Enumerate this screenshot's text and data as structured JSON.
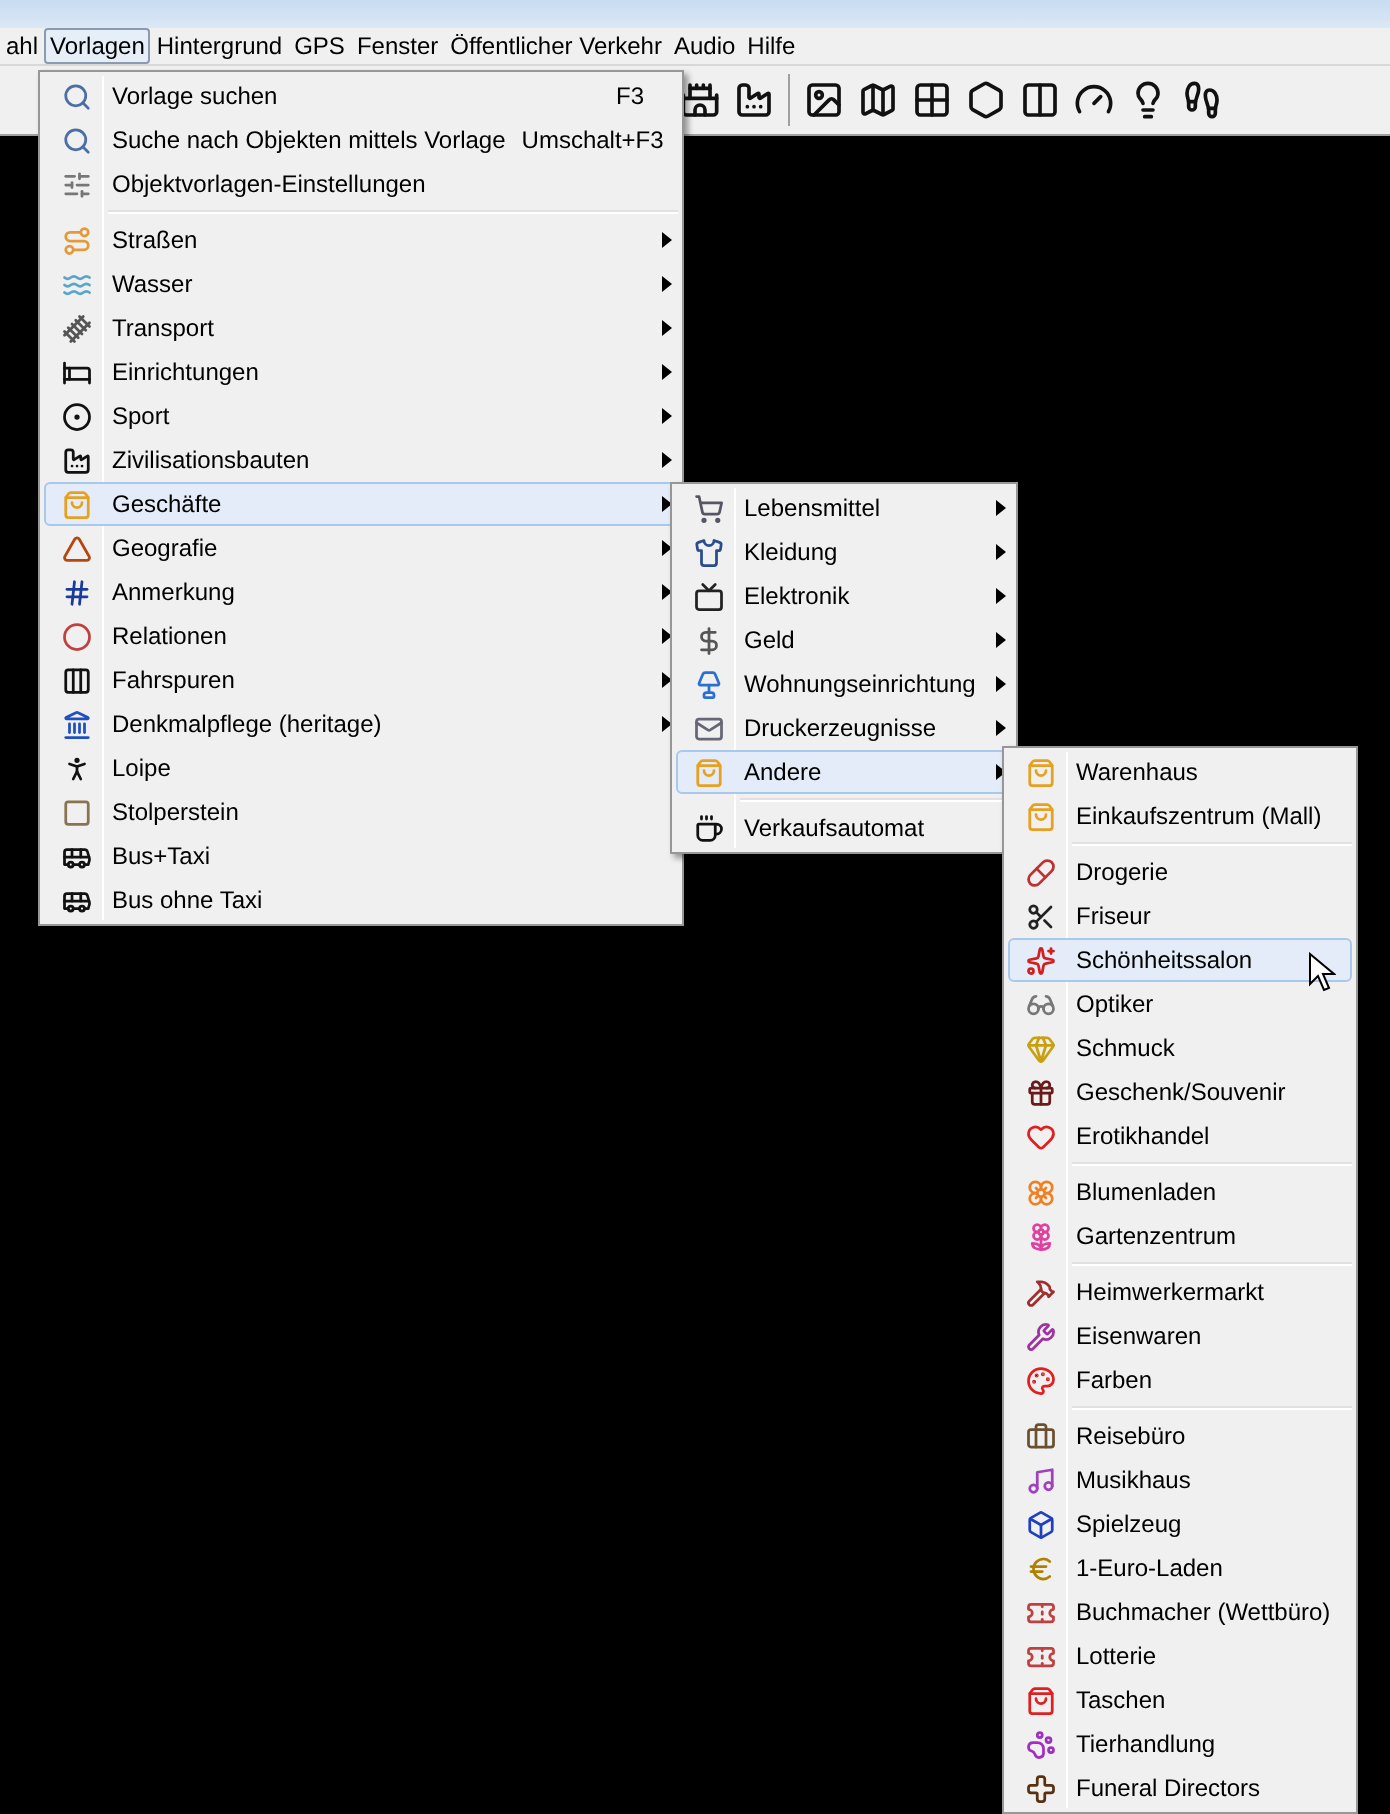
{
  "menu_bar": {
    "items": [
      {
        "label": "ahl",
        "selected": false
      },
      {
        "label": "Vorlagen",
        "selected": true
      },
      {
        "label": "Hintergrund",
        "selected": false
      },
      {
        "label": "GPS",
        "selected": false
      },
      {
        "label": "Fenster",
        "selected": false
      },
      {
        "label": "Öffentlicher Verkehr",
        "selected": false
      },
      {
        "label": "Audio",
        "selected": false
      },
      {
        "label": "Hilfe",
        "selected": false
      }
    ]
  },
  "presets_menu": {
    "groups": [
      [
        {
          "label": "Vorlage suchen",
          "shortcut": "F3",
          "submenu": false,
          "selected": false
        },
        {
          "label": "Suche nach Objekten mittels Vorlage",
          "shortcut": "Umschalt+F3",
          "submenu": false,
          "selected": false
        },
        {
          "label": "Objektvorlagen-Einstellungen",
          "submenu": false,
          "selected": false
        }
      ],
      [
        {
          "label": "Straßen",
          "submenu": true,
          "selected": false
        },
        {
          "label": "Wasser",
          "submenu": true,
          "selected": false
        },
        {
          "label": "Transport",
          "submenu": true,
          "selected": false
        },
        {
          "label": "Einrichtungen",
          "submenu": true,
          "selected": false
        },
        {
          "label": "Sport",
          "submenu": true,
          "selected": false
        },
        {
          "label": "Zivilisationsbauten",
          "submenu": true,
          "selected": false
        },
        {
          "label": "Geschäfte",
          "submenu": true,
          "selected": true
        },
        {
          "label": "Geografie",
          "submenu": true,
          "selected": false
        },
        {
          "label": "Anmerkung",
          "submenu": true,
          "selected": false
        },
        {
          "label": "Relationen",
          "submenu": true,
          "selected": false
        },
        {
          "label": "Fahrspuren",
          "submenu": true,
          "selected": false
        },
        {
          "label": "Denkmalpflege (heritage)",
          "submenu": true,
          "selected": false
        },
        {
          "label": "Loipe",
          "submenu": false,
          "selected": false
        },
        {
          "label": "Stolperstein",
          "submenu": false,
          "selected": false
        },
        {
          "label": "Bus+Taxi",
          "submenu": false,
          "selected": false
        },
        {
          "label": "Bus ohne Taxi",
          "submenu": false,
          "selected": false
        }
      ]
    ]
  },
  "shops_menu": {
    "groups": [
      [
        {
          "label": "Lebensmittel",
          "submenu": true,
          "selected": false
        },
        {
          "label": "Kleidung",
          "submenu": true,
          "selected": false
        },
        {
          "label": "Elektronik",
          "submenu": true,
          "selected": false
        },
        {
          "label": "Geld",
          "submenu": true,
          "selected": false
        },
        {
          "label": "Wohnungseinrichtung",
          "submenu": true,
          "selected": false
        },
        {
          "label": "Druckerzeugnisse",
          "submenu": true,
          "selected": false
        },
        {
          "label": "Andere",
          "submenu": true,
          "selected": true
        }
      ],
      [
        {
          "label": "Verkaufsautomat",
          "submenu": false,
          "selected": false
        }
      ]
    ]
  },
  "other_menu": {
    "groups": [
      [
        {
          "label": "Warenhaus",
          "submenu": false,
          "selected": false
        },
        {
          "label": "Einkaufszentrum (Mall)",
          "submenu": false,
          "selected": false
        }
      ],
      [
        {
          "label": "Drogerie",
          "submenu": false,
          "selected": false
        },
        {
          "label": "Friseur",
          "submenu": false,
          "selected": false
        },
        {
          "label": "Schönheitssalon",
          "submenu": false,
          "selected": true
        },
        {
          "label": "Optiker",
          "submenu": false,
          "selected": false
        },
        {
          "label": "Schmuck",
          "submenu": false,
          "selected": false
        },
        {
          "label": "Geschenk/Souvenir",
          "submenu": false,
          "selected": false
        },
        {
          "label": "Erotikhandel",
          "submenu": false,
          "selected": false
        }
      ],
      [
        {
          "label": "Blumenladen",
          "submenu": false,
          "selected": false
        },
        {
          "label": "Gartenzentrum",
          "submenu": false,
          "selected": false
        }
      ],
      [
        {
          "label": "Heimwerkermarkt",
          "submenu": false,
          "selected": false
        },
        {
          "label": "Eisenwaren",
          "submenu": false,
          "selected": false
        },
        {
          "label": "Farben",
          "submenu": false,
          "selected": false
        }
      ],
      [
        {
          "label": "Reisebüro",
          "submenu": false,
          "selected": false
        },
        {
          "label": "Musikhaus",
          "submenu": false,
          "selected": false
        },
        {
          "label": "Spielzeug",
          "submenu": false,
          "selected": false
        },
        {
          "label": "1-Euro-Laden",
          "submenu": false,
          "selected": false
        },
        {
          "label": "Buchmacher (Wettbüro)",
          "submenu": false,
          "selected": false
        },
        {
          "label": "Lotterie",
          "submenu": false,
          "selected": false
        },
        {
          "label": "Taschen",
          "submenu": false,
          "selected": false
        },
        {
          "label": "Tierhandlung",
          "submenu": false,
          "selected": false
        },
        {
          "label": "Funeral Directors",
          "submenu": false,
          "selected": false
        }
      ]
    ]
  }
}
